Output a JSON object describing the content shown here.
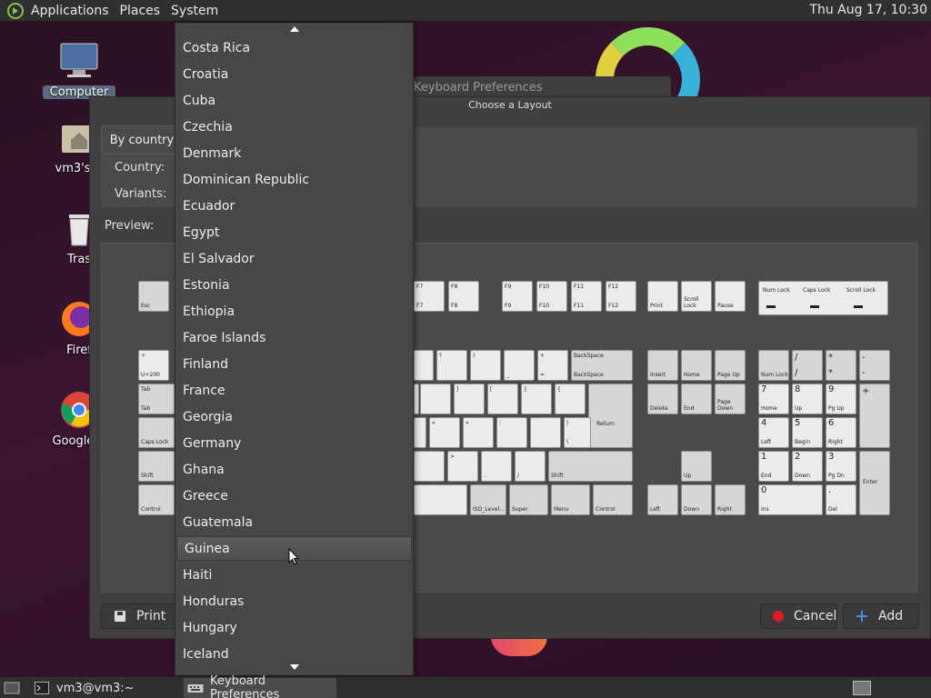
{
  "top_panel": {
    "menus": [
      "Applications",
      "Places",
      "System"
    ],
    "clock": "Thu Aug 17, 10:30"
  },
  "desktop": {
    "icons": [
      {
        "label": "Computer",
        "icon": "computer-icon"
      },
      {
        "label": "vm3's H",
        "icon": "home-folder-icon"
      },
      {
        "label": "Tras",
        "icon": "trash-icon"
      },
      {
        "label": "Firef",
        "icon": "firefox-icon"
      },
      {
        "label": "Google C",
        "icon": "chrome-icon"
      }
    ]
  },
  "background_window": {
    "title": "Keyboard Preferences"
  },
  "dialog": {
    "title": "Choose a Layout",
    "tab": "By country",
    "country_label": "Country:",
    "variants_label": "Variants:",
    "preview_label": "Preview:",
    "print_button": "Print",
    "cancel_button": "Cancel",
    "add_button": "Add",
    "colors": {
      "cancel_icon": "#e01b24",
      "add_icon": "#4a90d9"
    }
  },
  "keyboard_keys": {
    "esc": "Esc",
    "f7": "F7",
    "f8": "F8",
    "f9": "F9",
    "f10": "F10",
    "f11": "F11",
    "f12": "F12",
    "print": "Print",
    "scroll_lock": "Scroll Lock",
    "pause": "Pause",
    "num_lock": "Num Lock",
    "caps_lock_ind": "Caps Lock",
    "scroll_lock_ind": "Scroll Lock",
    "backspace": "BackSpace",
    "tab": "Tab",
    "caps": "Caps Lock",
    "shift": "Shift",
    "control": "Control",
    "return": "Return",
    "iso_level": "ISO_Level...",
    "super": "Super",
    "menu": "Menu",
    "insert": "Insert",
    "home": "Home",
    "page_up": "Page Up",
    "delete": "Delete",
    "end": "End",
    "page_down": "Page Down",
    "up": "Up",
    "left": "Left",
    "down": "Down",
    "right": "Right",
    "kp_7": "7",
    "kp_7b": "Home",
    "kp_8": "8",
    "kp_8b": "Up",
    "kp_9": "9",
    "kp_9b": "Pg Up",
    "kp_4": "4",
    "kp_4b": "Left",
    "kp_5": "5",
    "kp_5b": "Begin",
    "kp_6": "6",
    "kp_6b": "Right",
    "kp_1": "1",
    "kp_1b": "End",
    "kp_2": "2",
    "kp_2b": "Down",
    "kp_3": "3",
    "kp_3b": "Pg Dn",
    "kp_0": "0",
    "kp_0b": "Ins",
    "kp_dot": ".",
    "kp_dotb": "Del",
    "kp_enter": "Enter",
    "kp_div": "/",
    "kp_mul": "*",
    "kp_minus": "-",
    "kp_plus": "+",
    "k_div_mul": "÷",
    "k_u200": "U+200",
    "k1a": "؟",
    "k1b": ")",
    "k1c": "_",
    "k1d": "+",
    "k1e": "=",
    "k2a": "[",
    "k2b": "]",
    "k2c": "{",
    "k2d": "}",
    "k3a": "»",
    "k3b": "«",
    "k3c": ":",
    "k3d": "|",
    "k3e": "\\",
    "k4a": ">",
    "k4b": ".",
    "k4c": "/",
    "k4d": "?"
  },
  "country_list": {
    "items": [
      "Costa Rica",
      "Croatia",
      "Cuba",
      "Czechia",
      "Denmark",
      "Dominican Republic",
      "Ecuador",
      "Egypt",
      "El Salvador",
      "Estonia",
      "Ethiopia",
      "Faroe Islands",
      "Finland",
      "France",
      "Georgia",
      "Germany",
      "Ghana",
      "Greece",
      "Guatemala",
      "Guinea",
      "Haiti",
      "Honduras",
      "Hungary",
      "Iceland"
    ],
    "hovered": "Guinea"
  },
  "bottom_panel": {
    "tasks": [
      {
        "label": "vm3@vm3:~",
        "icon": "terminal-icon"
      },
      {
        "label": "Keyboard Preferences",
        "icon": "keyboard-icon"
      }
    ]
  }
}
